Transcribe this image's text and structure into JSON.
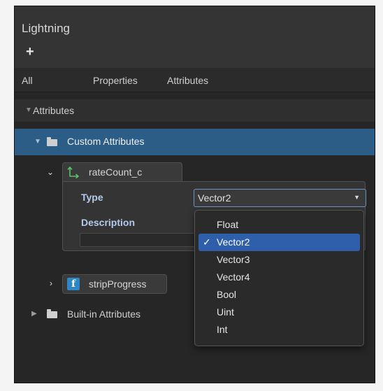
{
  "panel": {
    "title": "Lightning",
    "add_label": "+"
  },
  "tabs": [
    {
      "label": "All"
    },
    {
      "label": "Properties"
    },
    {
      "label": "Attributes"
    }
  ],
  "tree": {
    "category_label": "Attributes",
    "custom_label": "Custom Attributes",
    "builtin_label": "Built-in Attributes",
    "expanded_arrow": "▼",
    "collapsed_arrow": "▶"
  },
  "attributes": [
    {
      "name": "rateCount_c",
      "icon": "vector-axes-icon",
      "expanded": true,
      "type_label": "Type",
      "type_value": "Vector2",
      "description_label": "Description",
      "description_value": ""
    },
    {
      "name": "stripProgress",
      "icon": "float-f-icon",
      "icon_glyph": "f",
      "expanded": false
    }
  ],
  "dropdown": {
    "selected_check": "✓",
    "options": [
      "Float",
      "Vector2",
      "Vector3",
      "Vector4",
      "Bool",
      "Uint",
      "Int"
    ],
    "selected": "Vector2"
  },
  "colors": {
    "selection_row": "#2c5d87",
    "dropdown_highlight": "#2f5faa",
    "field_label": "#b4c9ee",
    "vector_icon": "#57c46a",
    "float_icon_bg": "#2e86c4"
  }
}
